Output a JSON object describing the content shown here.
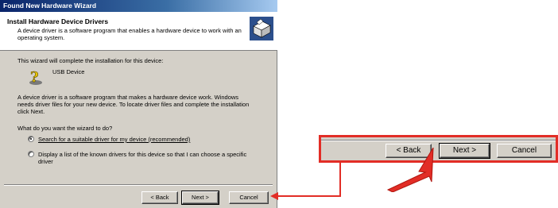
{
  "window": {
    "title": "Found New Hardware Wizard"
  },
  "header": {
    "title": "Install Hardware Device Drivers",
    "subtitle": "A device driver is a software program that enables a hardware device to work with an operating system."
  },
  "content": {
    "intro": "This wizard will complete the installation for this device:",
    "device_name": "USB Device",
    "description": "A device driver is a software program that makes a hardware device work. Windows needs driver files for your new device. To locate driver files and complete the installation click Next.",
    "question": "What do you want the wizard to do?",
    "option_recommended": "Search for a suitable driver for my device (recommended)",
    "option_list": "Display a list of the known drivers for this device so that I can choose a specific driver"
  },
  "buttons": {
    "back": "< Back",
    "next": "Next >",
    "cancel": "Cancel"
  },
  "zoom_buttons": {
    "back": "< Back",
    "next": "Next >",
    "cancel": "Cancel"
  },
  "colors": {
    "annotation": "#e22d26",
    "titlebar": "#0a246a",
    "dialog_bg": "#d4d0c8"
  },
  "icons": {
    "header": "hardware-box-icon",
    "device": "unknown-device-icon",
    "pointer": "red-arrow-pointer"
  }
}
